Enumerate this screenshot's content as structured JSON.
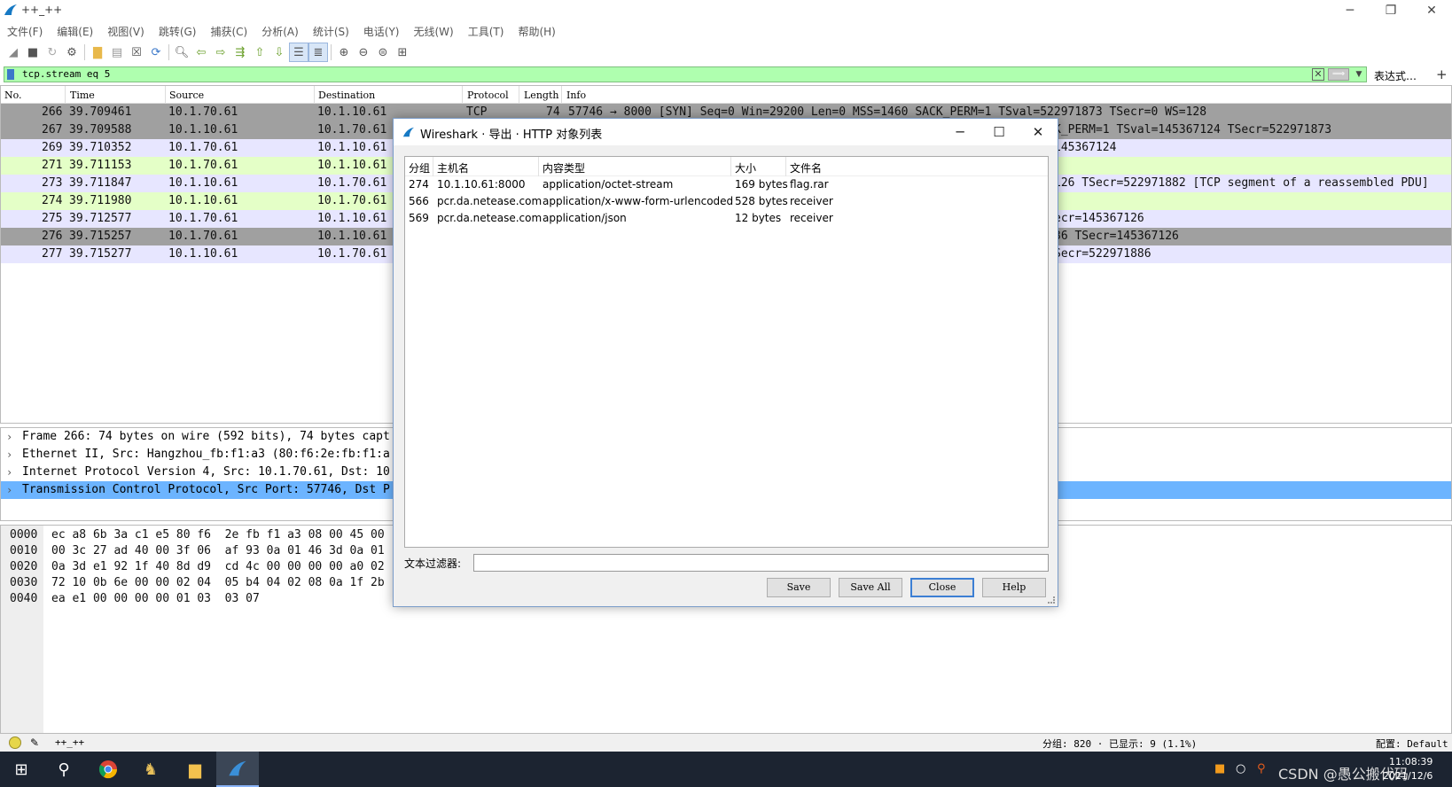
{
  "window": {
    "title": "++_++"
  },
  "menu": [
    "文件(F)",
    "编辑(E)",
    "视图(V)",
    "跳转(G)",
    "捕获(C)",
    "分析(A)",
    "统计(S)",
    "电话(Y)",
    "无线(W)",
    "工具(T)",
    "帮助(H)"
  ],
  "filter": {
    "value": "tcp.stream eq 5",
    "expression_label": "表达式…",
    "plus_label": "+"
  },
  "packet_list": {
    "columns": [
      "No.",
      "Time",
      "Source",
      "Destination",
      "Protocol",
      "Length",
      "Info"
    ],
    "rows": [
      {
        "no": "266",
        "time": "39.709461",
        "src": "10.1.70.61",
        "dst": "10.1.10.61",
        "proto": "TCP",
        "len": "74",
        "info": "57746 → 8000 [SYN] Seq=0 Win=29200 Len=0 MSS=1460 SACK_PERM=1 TSval=522971873 TSecr=0 WS=128"
      },
      {
        "no": "267",
        "time": "39.709588",
        "src": "10.1.10.61",
        "dst": "10.1.70.61",
        "proto": "",
        "len": "",
        "info": "K_PERM=1 TSval=145367124 TSecr=522971873"
      },
      {
        "no": "269",
        "time": "39.710352",
        "src": "10.1.70.61",
        "dst": "10.1.10.61",
        "proto": "",
        "len": "",
        "info": "145367124"
      },
      {
        "no": "271",
        "time": "39.711153",
        "src": "10.1.70.61",
        "dst": "10.1.10.61",
        "proto": "",
        "len": "",
        "info": ""
      },
      {
        "no": "273",
        "time": "39.711847",
        "src": "10.1.10.61",
        "dst": "10.1.70.61",
        "proto": "",
        "len": "",
        "info": "126 TSecr=522971882 [TCP segment of a reassembled PDU]"
      },
      {
        "no": "274",
        "time": "39.711980",
        "src": "10.1.10.61",
        "dst": "10.1.70.61",
        "proto": "",
        "len": "",
        "info": ""
      },
      {
        "no": "275",
        "time": "39.712577",
        "src": "10.1.70.61",
        "dst": "10.1.10.61",
        "proto": "",
        "len": "",
        "info": "ecr=145367126"
      },
      {
        "no": "276",
        "time": "39.715257",
        "src": "10.1.70.61",
        "dst": "10.1.10.61",
        "proto": "",
        "len": "",
        "info": "36 TSecr=145367126"
      },
      {
        "no": "277",
        "time": "39.715277",
        "src": "10.1.10.61",
        "dst": "10.1.70.61",
        "proto": "",
        "len": "",
        "info": "Secr=522971886"
      }
    ]
  },
  "details": [
    "Frame 266: 74 bytes on wire (592 bits), 74 bytes capt",
    "Ethernet II, Src: Hangzhou_fb:f1:a3 (80:f6:2e:fb:f1:a",
    "Internet Protocol Version 4, Src: 10.1.70.61, Dst: 10",
    "Transmission Control Protocol, Src Port: 57746, Dst P"
  ],
  "hex": {
    "offsets": [
      "0000",
      "0010",
      "0020",
      "0030",
      "0040"
    ],
    "bytes": [
      "ec a8 6b 3a c1 e5 80 f6  2e fb f1 a3 08 00 45 00",
      "00 3c 27 ad 40 00 3f 06  af 93 0a 01 46 3d 0a 01",
      "0a 3d e1 92 1f 40 8d d9  cd 4c 00 00 00 00 a0 02",
      "72 10 0b 6e 00 00 02 04  05 b4 04 02 08 0a 1f 2b",
      "ea e1 00 00 00 00 01 03  03 07"
    ]
  },
  "statusbar": {
    "profile_text": "++_++",
    "packets": "分组: 820 · 已显示: 9 (1.1%)",
    "config": "配置: Default"
  },
  "taskbar": {
    "time": "11:08:39",
    "date": "2021/12/6",
    "watermark": "CSDN @愚公搬代码"
  },
  "dialog": {
    "title": "Wireshark · 导出 · HTTP 对象列表",
    "columns": [
      "分组",
      "主机名",
      "内容类型",
      "大小",
      "文件名"
    ],
    "rows": [
      {
        "packet": "274",
        "host": "10.1.10.61:8000",
        "content_type": "application/octet-stream",
        "size": "169 bytes",
        "filename": "flag.rar"
      },
      {
        "packet": "566",
        "host": "pcr.da.netease.com",
        "content_type": "application/x-www-form-urlencoded",
        "size": "528 bytes",
        "filename": "receiver"
      },
      {
        "packet": "569",
        "host": "pcr.da.netease.com",
        "content_type": "application/json",
        "size": "12 bytes",
        "filename": "receiver"
      }
    ],
    "text_filter_label": "文本过滤器:",
    "text_filter_value": "",
    "buttons": {
      "save": "Save",
      "save_all": "Save All",
      "close": "Close",
      "help": "Help"
    }
  },
  "colors": {
    "row_gray": "#a0a0a0",
    "row_lavender": "#e7e6ff",
    "row_green": "#e4ffc7",
    "filter_green": "#afffaf",
    "selection_blue": "#6cb4ff"
  }
}
